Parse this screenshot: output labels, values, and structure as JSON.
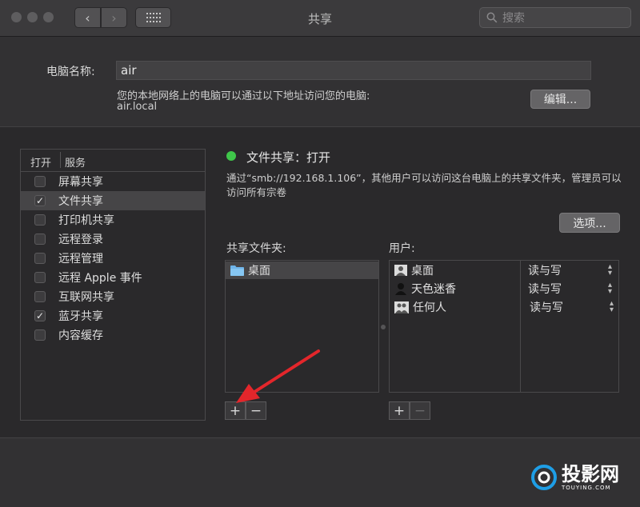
{
  "window": {
    "title": "共享",
    "search_placeholder": "搜索"
  },
  "computer_name": {
    "label": "电脑名称:",
    "value": "air",
    "description": "您的本地网络上的电脑可以通过以下地址访问您的电脑:",
    "address": "air.local",
    "edit_button": "编辑..."
  },
  "services": {
    "header_on": "打开",
    "header_service": "服务",
    "items": [
      {
        "label": "屏幕共享",
        "checked": false
      },
      {
        "label": "文件共享",
        "checked": true
      },
      {
        "label": "打印机共享",
        "checked": false
      },
      {
        "label": "远程登录",
        "checked": false
      },
      {
        "label": "远程管理",
        "checked": false
      },
      {
        "label": "远程 Apple 事件",
        "checked": false
      },
      {
        "label": "互联网共享",
        "checked": false
      },
      {
        "label": "蓝牙共享",
        "checked": true
      },
      {
        "label": "内容缓存",
        "checked": false
      }
    ]
  },
  "file_sharing": {
    "status": "文件共享：打开",
    "status_color": "#3fc64a",
    "description": "通过“smb://192.168.1.106”，其他用户可以访问这台电脑上的共享文件夹，管理员可以访问所有宗卷",
    "options_button": "选项...",
    "folders_label": "共享文件夹:",
    "folders": [
      "桌面"
    ],
    "users_label": "用户:",
    "users": [
      {
        "name": "桌面",
        "permission": "读与写",
        "icon": "user-single-icon"
      },
      {
        "name": "天色迷香",
        "permission": "读与写",
        "icon": "user-silhouette-icon"
      },
      {
        "name": "任何人",
        "permission": "读与写",
        "icon": "group-icon"
      }
    ],
    "add_symbol": "+",
    "remove_symbol": "−"
  },
  "watermark": {
    "text": "投影网",
    "sub": "TOUYING.COM",
    "accent": "#1e9ee6"
  }
}
